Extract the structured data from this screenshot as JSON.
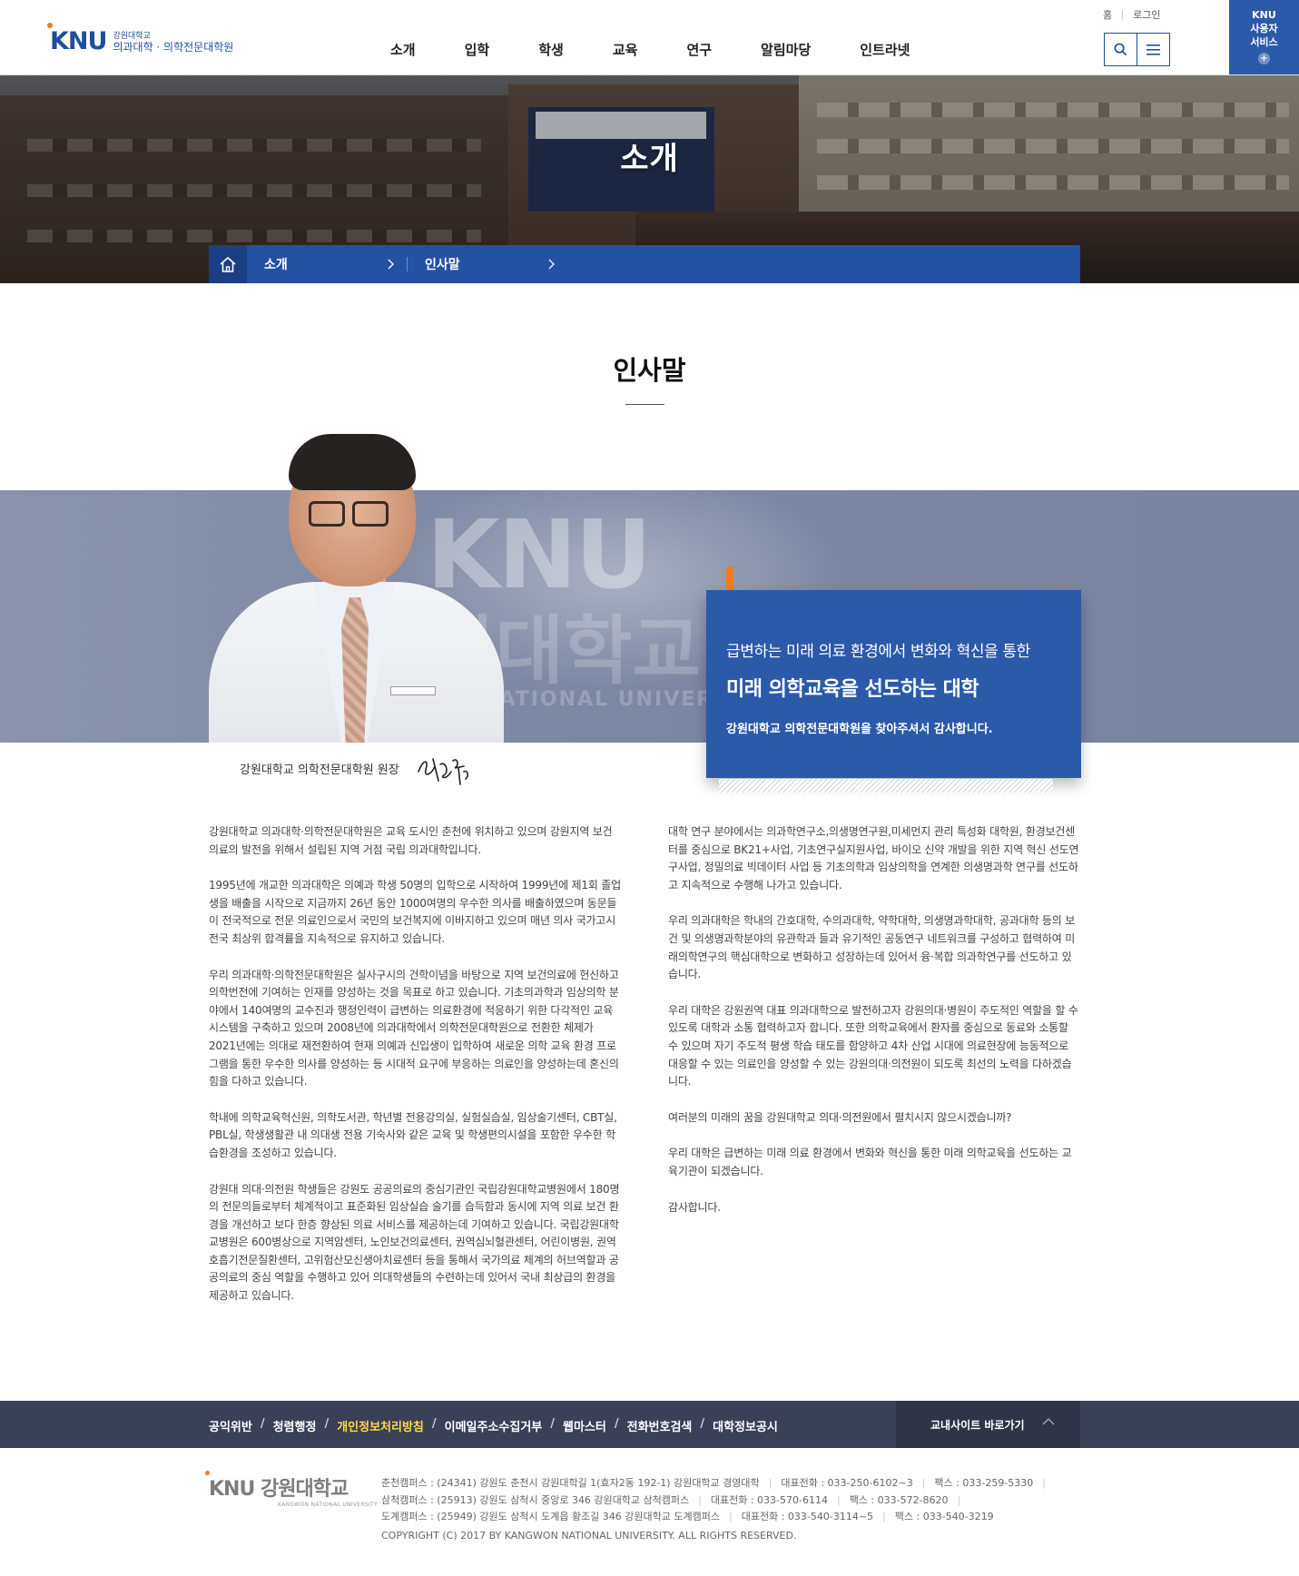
{
  "header": {
    "logo": {
      "mark": "KNU",
      "small": "강원대학교",
      "name": "의과대학 · 의학전문대학원"
    },
    "nav": [
      "소개",
      "입학",
      "학생",
      "교육",
      "연구",
      "알림마당",
      "인트라넷"
    ],
    "utils": {
      "home": "홈",
      "login": "로그인"
    },
    "icons": {
      "search": "search-icon",
      "menu": "hamburger-icon"
    },
    "knu_service": {
      "line1": "KNU",
      "line2": "사용자",
      "line3": "서비스",
      "plus": "+"
    }
  },
  "visual": {
    "title": "소개"
  },
  "location": {
    "depth1": "소개",
    "depth2": "인사말"
  },
  "content": {
    "title": "인사말",
    "band": {
      "knu": "KNU",
      "korean": "원대학교",
      "english": "NATIONAL UNIVERSITY"
    },
    "caption": "강원대학교 의학전문대학원 원장",
    "quote": {
      "line1": "급변하는 미래 의료 환경에서 변화와 혁신을 통한",
      "line2": "미래 의학교육을 선도하는 대학",
      "line3": "강원대학교 의학전문대학원을 찾아주셔서 감사합니다."
    },
    "left_paragraphs": [
      "강원대학교 의과대학·의학전문대학원은 교육 도시인 춘천에 위치하고 있으며 강원지역 보건의료의 발전을 위해서 설립된 지역 거점 국립 의과대학입니다.",
      "1995년에 개교한 의과대학은 의예과 학생 50명의 입학으로 시작하여 1999년에 제1회 졸업생을 배출을 시작으로 지금까지 26년 동안 1000여명의 우수한 의사를 배출하였으며 동문들이 전국적으로 전문 의료인으로서 국민의 보건복지에 이바지하고 있으며 매년 의사 국가고시 전국 최상위 합격률을 지속적으로 유지하고 있습니다.",
      "우리 의과대학·의학전문대학원은 실사구시의 건학이념을 바탕으로 지역 보건의료에 헌신하고 의학번전에 기여하는 인재를 양성하는 것을 목표로 하고 있습니다. 기초의과학과 임상의학 분야에서 140여명의 교수진과 행정인력이 급변하는 의료환경에 적응하기 위한 다각적인 교육시스템을 구축하고 있으며 2008년에 의과대학에서 의학전문대학원으로 전환한 체제가 2021년에는 의대로 재전환하여 현재 의예과 신입생이 입학하여 새로운 의학 교육 환경 프로그램을 통한 우수한 의사를 양성하는 등 시대적 요구에 부응하는 의료인을 양성하는데 혼신의 힘을 다하고 있습니다.",
      "학내에 의학교육혁신원, 의학도서관, 학년별 전용강의실, 실험실습실, 임상술기센터, CBT실, PBL실, 학생생활관 내 의대생 전용 기숙사와 같은 교육 및 학생편의시설을 포함한 우수한 학습환경을 조성하고 있습니다.",
      "강원대 의대·의전원 학생들은 강원도 공공의료의 중심기관인 국립강원대학교병원에서 180명의 전문의들로부터 체계적이고 표준화된 임상실습 술기를 습득함과 동시에 지역 의료 보건 환경을 개선하고 보다 한층 향상된 의료 서비스를 제공하는데 기여하고 있습니다. 국립강원대학교병원은 600병상으로 지역암센터, 노인보건의료센터, 권역심뇌혈관센터, 어린이병원, 권역호흡기전문질환센터, 고위험산모신생아치료센터 등을 통해서 국가의료 체계의 허브역할과 공공의료의 중심 역할을 수행하고 있어 의대학생들의 수련하는데 있어서 국내 최상급의 환경을 제공하고 있습니다."
    ],
    "right_paragraphs": [
      "대학 연구 분야에서는 의과학연구소,의생명연구원,미세먼지 관리 특성화 대학원, 환경보건센터를 중심으로 BK21+사업, 기초연구실지원사업, 바이오 신약 개발을 위한 지역 혁신 선도연구사업, 정밀의료 빅데이터 사업 등 기초의학과 임상의학을 연계한 의생명과학 연구를 선도하고 지속적으로 수행해 나가고 있습니다.",
      "우리 의과대학은 학내의 간호대학, 수의과대학, 약학대학, 의생명과학대학, 공과대학 등의 보건 및 의생명과학분야의 유관학과 들과 유기적인 공동연구 네트워크를 구성하고 협력하여 미래의학연구의 핵심대학으로 변화하고 성장하는데 있어서 융·복합 의과학연구를 선도하고 있습니다.",
      "우리 대학은 강원권역 대표 의과대학으로 발전하고자 강원의대·병원이 주도적인 역할을 할 수 있도록 대학과 소통 협력하고자 합니다. 또한 의학교육에서 환자를 중심으로 동료와 소통할 수 있으며 자기 주도적 평생 학습 태도를 함양하고 4차 산업 시대에 의료현장에 능동적으로 대응할 수 있는 의료인을 양성할 수 있는 강원의대·의전원이 되도록 최선의 노력을 다하겠습니다.",
      "여러분의 미래의 꿈을 강원대학교 의대·의전원에서 펼치시지 않으시겠습니까?",
      "우리 대학은 급변하는 미래 의료 환경에서 변화와 혁신을 통한 미래 의학교육을 선도하는 교육기관이 되겠습니다.",
      "감사합니다."
    ]
  },
  "footer": {
    "links": [
      "공익위반",
      "청렴행정",
      "개인정보처리방침",
      "이메일주소수집거부",
      "웹마스터",
      "전화번호검색",
      "대학정보공시"
    ],
    "link_separator": "/",
    "family_site": "교내사이트 바로가기",
    "logo": {
      "mark": "KNU",
      "name": "강원대학교",
      "sub": "KANGWON NATIONAL UNIVERSITY"
    },
    "campus": [
      {
        "addr": "춘천캠퍼스 : (24341) 강원도 춘천시 강원대학길 1(효자2동 192-1) 강원대학교 경영대학",
        "tel": "대표전화 : 033-250-6102~3",
        "fax": "팩스 : 033-259-5330"
      },
      {
        "addr": "삼척캠퍼스 : (25913) 강원도 삼척시 중앙로 346 강원대학교 삼척캠퍼스",
        "tel": "대표전화 : 033-570-6114",
        "fax": "팩스 : 033-572-8620"
      },
      {
        "addr": "도계캠퍼스 : (25949) 강원도 삼척시 도계읍 황조길 346 강원대학교 도계캠퍼스",
        "tel": "대표전화 : 033-540-3114~5",
        "fax": "팩스 : 033-540-3219"
      }
    ],
    "copyright": "COPYRIGHT (C) 2017 BY KANGWON NATIONAL UNIVERSITY. ALL RIGHTS RESERVED."
  },
  "colors": {
    "brand_blue": "#2b5aa9",
    "accent_orange": "#f07c1d",
    "footer_dark": "#3a4056",
    "highlight_yellow": "#ffd94a"
  }
}
